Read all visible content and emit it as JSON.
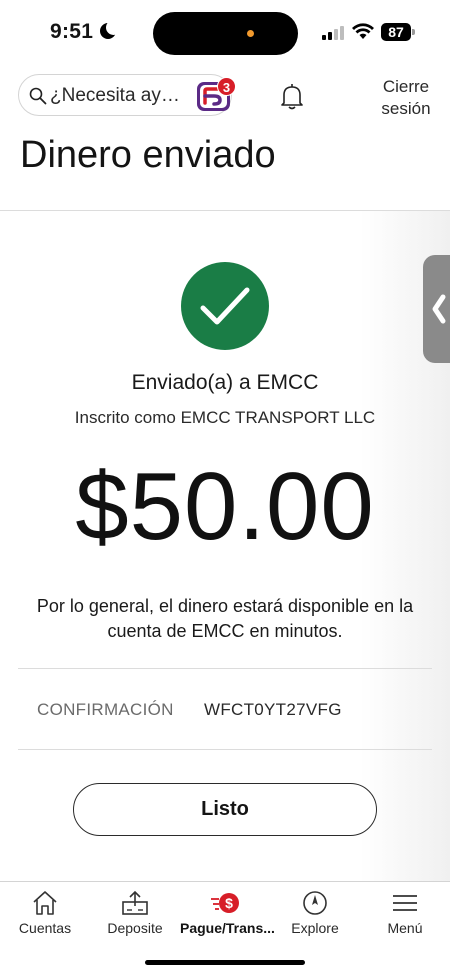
{
  "status_bar": {
    "time": "9:51",
    "battery": "87"
  },
  "header": {
    "search_placeholder": "¿Necesita ay…",
    "fargo_badge": "3",
    "logout_label": "Cierre sesión",
    "title": "Dinero enviado"
  },
  "confirmation": {
    "sent_to": "Enviado(a) a EMCC",
    "registered_as": "Inscrito como EMCC TRANSPORT LLC",
    "amount": "$50.00",
    "availability": "Por lo general, el dinero estará disponible en la cuenta de EMCC en minutos.",
    "confirmation_label": "CONFIRMACIÓN",
    "confirmation_number": "WFCT0YT27VFG",
    "done_label": "Listo"
  },
  "nav": {
    "items": [
      {
        "label": "Cuentas",
        "icon": "home-icon"
      },
      {
        "label": "Deposite",
        "icon": "deposit-icon"
      },
      {
        "label": "Pague/Trans...",
        "icon": "pay-transfer-icon"
      },
      {
        "label": "Explore",
        "icon": "compass-icon"
      },
      {
        "label": "Menú",
        "icon": "menu-icon"
      }
    ],
    "active_index": 2
  },
  "colors": {
    "success_green": "#1a7d46",
    "brand_red": "#d71e28",
    "fargo_purple": "#5b2a86"
  }
}
